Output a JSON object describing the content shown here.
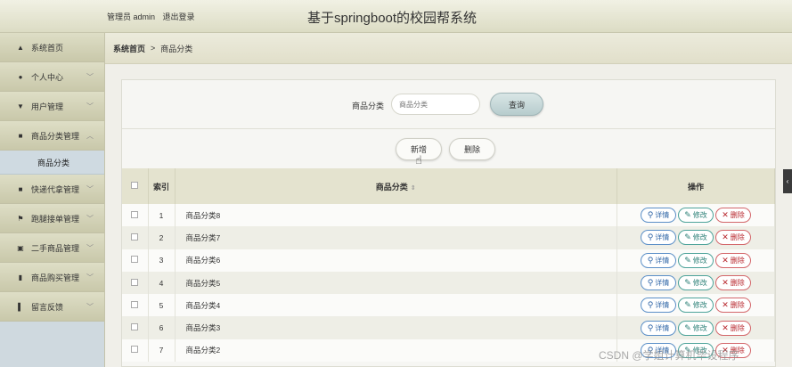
{
  "header": {
    "user_label": "管理员 admin",
    "logout": "退出登录",
    "title": "基于springboot的校园帮系统"
  },
  "sidebar": {
    "items": [
      {
        "label": "系统首页",
        "icon": "home-icon",
        "glyph": "▲",
        "chevron": ""
      },
      {
        "label": "个人中心",
        "icon": "person-icon",
        "glyph": "●",
        "chevron": "﹀"
      },
      {
        "label": "用户管理",
        "icon": "user-manage-icon",
        "glyph": "▼",
        "chevron": "﹀"
      },
      {
        "label": "商品分类管理",
        "icon": "grid-icon",
        "glyph": "■",
        "chevron": "︿"
      },
      {
        "label": "快递代拿管理",
        "icon": "grid-icon",
        "glyph": "■",
        "chevron": "﹀"
      },
      {
        "label": "跑腿接单管理",
        "icon": "flag-icon",
        "glyph": "⚑",
        "chevron": "﹀"
      },
      {
        "label": "二手商品管理",
        "icon": "clipboard-icon",
        "glyph": "▣",
        "chevron": "﹀"
      },
      {
        "label": "商品购买管理",
        "icon": "bar-chart-icon",
        "glyph": "▮",
        "chevron": "﹀"
      },
      {
        "label": "留言反馈",
        "icon": "book-icon",
        "glyph": "▌",
        "chevron": "﹀"
      }
    ],
    "sub_item": "商品分类"
  },
  "breadcrumb": {
    "root": "系统首页",
    "sep": ">",
    "current": "商品分类"
  },
  "search": {
    "label": "商品分类",
    "placeholder": "商品分类",
    "button": "查询"
  },
  "actions": {
    "add": "新增",
    "delete": "删除"
  },
  "table": {
    "col_index": "索引",
    "col_name": "商品分类",
    "col_ops": "操作",
    "op_detail": "详情",
    "op_edit": "修改",
    "op_delete": "删除",
    "rows": [
      {
        "idx": "1",
        "name": "商品分类8"
      },
      {
        "idx": "2",
        "name": "商品分类7"
      },
      {
        "idx": "3",
        "name": "商品分类6"
      },
      {
        "idx": "4",
        "name": "商品分类5"
      },
      {
        "idx": "5",
        "name": "商品分类4"
      },
      {
        "idx": "6",
        "name": "商品分类3"
      },
      {
        "idx": "7",
        "name": "商品分类2"
      }
    ]
  },
  "watermark": "CSDN @学姐计算机毕设程序"
}
